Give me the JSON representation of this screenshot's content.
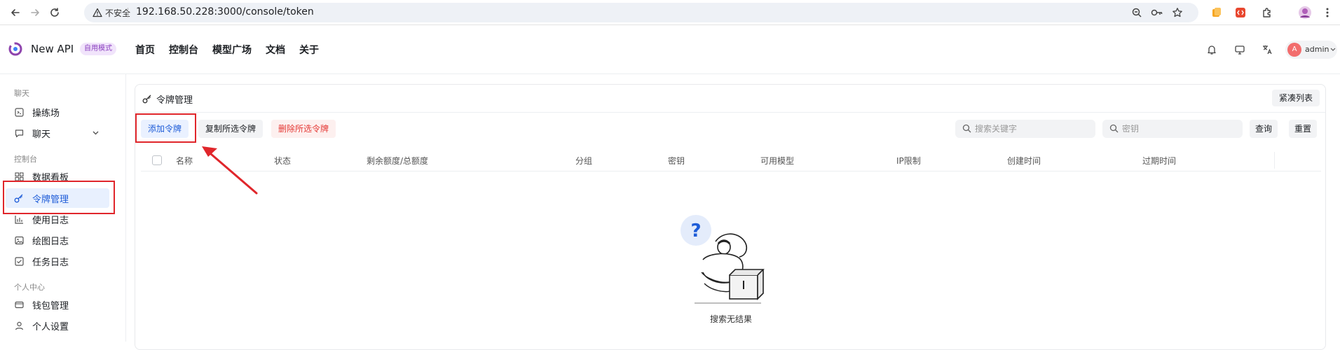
{
  "browser": {
    "security_label": "不安全",
    "url": "192.168.50.228:3000/console/token"
  },
  "header": {
    "brand": "New API",
    "mode_badge": "自用模式",
    "nav": [
      "首页",
      "控制台",
      "模型广场",
      "文档",
      "关于"
    ],
    "user": {
      "initial": "A",
      "name": "admin"
    }
  },
  "sidebar": {
    "sections": [
      {
        "title": "聊天",
        "items": [
          {
            "label": "操练场",
            "icon": "playground-icon"
          },
          {
            "label": "聊天",
            "icon": "chat-icon",
            "expandable": true
          }
        ]
      },
      {
        "title": "控制台",
        "items": [
          {
            "label": "数据看板",
            "icon": "dashboard-icon"
          },
          {
            "label": "令牌管理",
            "icon": "key-icon",
            "active": true
          },
          {
            "label": "使用日志",
            "icon": "bar-chart-icon"
          },
          {
            "label": "绘图日志",
            "icon": "image-icon"
          },
          {
            "label": "任务日志",
            "icon": "checklist-icon"
          }
        ]
      },
      {
        "title": "个人中心",
        "items": [
          {
            "label": "钱包管理",
            "icon": "wallet-icon"
          },
          {
            "label": "个人设置",
            "icon": "user-icon"
          }
        ]
      }
    ]
  },
  "main": {
    "title": "令牌管理",
    "compact_toggle": "紧凑列表",
    "actions": {
      "add": "添加令牌",
      "copy": "复制所选令牌",
      "delete": "删除所选令牌"
    },
    "search": {
      "keyword_placeholder": "搜索关键字",
      "key_placeholder": "密钥",
      "query": "查询",
      "reset": "重置"
    },
    "columns": [
      "名称",
      "状态",
      "剩余额度/总额度",
      "分组",
      "密钥",
      "可用模型",
      "IP限制",
      "创建时间",
      "过期时间"
    ],
    "empty_text": "搜索无结果"
  },
  "colors": {
    "accent": "#1f5dd8",
    "danger": "#e53935",
    "annotation": "#e0262b"
  }
}
